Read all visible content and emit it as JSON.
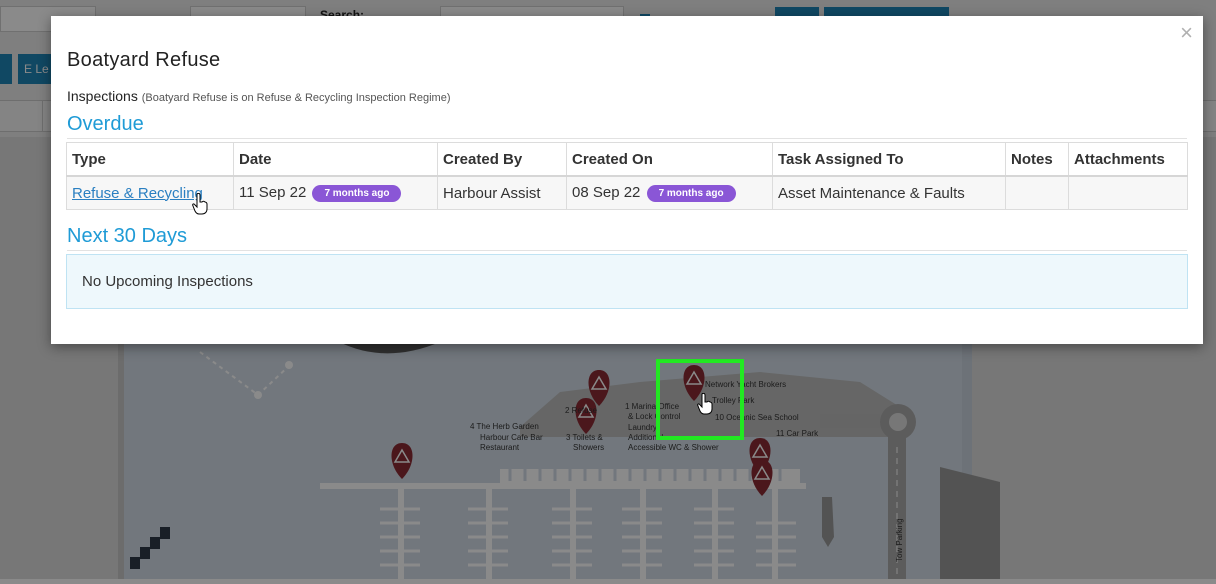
{
  "background": {
    "search_label": "Search:",
    "left_button_label": "E Le"
  },
  "map": {
    "labels": [
      "Network Yacht Brokers",
      "Trolley Park",
      "10 Oceanic Sea School",
      "11 Car Park",
      "4  The Herb Garden",
      "Harbour Cafe Bar",
      "Restaurant",
      "1 Marina Office",
      "& Lock Control",
      "Laundry",
      "Additional",
      "Accessible WC & Shower",
      "2 Refuse",
      "3 Toilets &",
      "Showers",
      "Tow Parking"
    ]
  },
  "modal": {
    "close_glyph": "×",
    "title": "Boatyard Refuse",
    "inspections_label": "Inspections",
    "inspections_sub": "(Boatyard Refuse is on Refuse & Recycling Inspection Regime)",
    "overdue_heading": "Overdue",
    "next_heading": "Next 30 Days",
    "columns": [
      "Type",
      "Date",
      "Created By",
      "Created On",
      "Task Assigned To",
      "Notes",
      "Attachments"
    ],
    "row": {
      "type": "Refuse & Recycling",
      "date": "11 Sep 22",
      "date_badge": "7 months ago",
      "created_by": "Harbour Assist",
      "created_on": "08 Sep 22",
      "created_badge": "7 months ago",
      "task_assigned_to": "Asset Maintenance & Faults",
      "notes": "",
      "attachments": ""
    },
    "empty_message": "No Upcoming Inspections"
  },
  "colors": {
    "accent": "#1f9bd6",
    "badge": "#8a56d6",
    "marker": "#8b2b34",
    "highlight": "#22e822"
  }
}
